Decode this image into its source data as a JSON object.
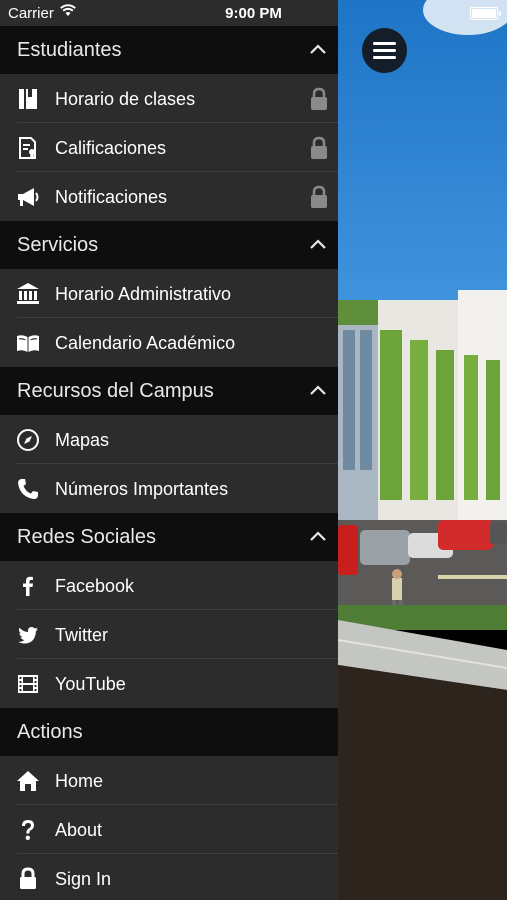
{
  "status_bar": {
    "carrier": "Carrier",
    "time": "9:00 PM"
  },
  "menu": {
    "sections": [
      {
        "title": "Estudiantes",
        "collapsible": true,
        "items": [
          {
            "label": "Horario de clases",
            "icon": "book-icon",
            "locked": true
          },
          {
            "label": "Calificaciones",
            "icon": "grades-document-icon",
            "locked": true
          },
          {
            "label": "Notificaciones",
            "icon": "megaphone-icon",
            "locked": true
          }
        ]
      },
      {
        "title": "Servicios",
        "collapsible": true,
        "items": [
          {
            "label": "Horario Administrativo",
            "icon": "bank-building-icon",
            "locked": false
          },
          {
            "label": "Calendario Académico",
            "icon": "open-book-icon",
            "locked": false
          }
        ]
      },
      {
        "title": "Recursos del Campus",
        "collapsible": true,
        "items": [
          {
            "label": "Mapas",
            "icon": "compass-icon",
            "locked": false
          },
          {
            "label": "Números Importantes",
            "icon": "phone-icon",
            "locked": false
          }
        ]
      },
      {
        "title": "Redes Sociales",
        "collapsible": true,
        "items": [
          {
            "label": "Facebook",
            "icon": "facebook-icon",
            "locked": false
          },
          {
            "label": "Twitter",
            "icon": "twitter-bird-icon",
            "locked": false
          },
          {
            "label": "YouTube",
            "icon": "film-strip-icon",
            "locked": false
          }
        ]
      },
      {
        "title": "Actions",
        "collapsible": false,
        "items": [
          {
            "label": "Home",
            "icon": "home-icon",
            "locked": false
          },
          {
            "label": "About",
            "icon": "question-mark-icon",
            "locked": false
          },
          {
            "label": "Sign In",
            "icon": "padlock-icon",
            "locked": false
          }
        ]
      }
    ]
  },
  "colors": {
    "menu_bg": "#2c2c2c",
    "header_bg": "#0e0e0e",
    "divider": "#3f3f3f",
    "text": "#ffffff",
    "lock_gray": "#8a8a8a"
  },
  "hamburger_icon": "menu-icon"
}
